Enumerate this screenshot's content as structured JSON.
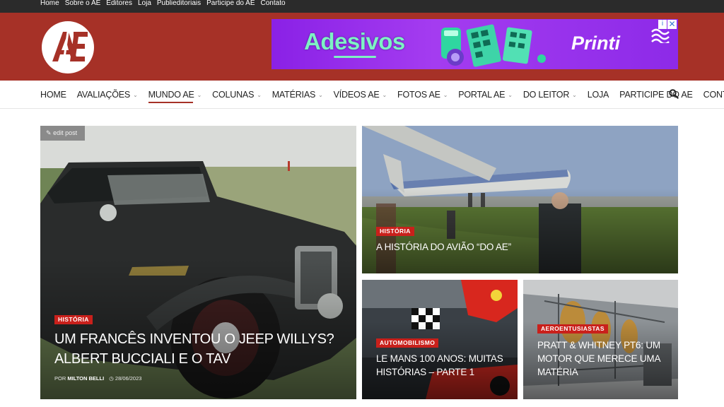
{
  "topbar": {
    "links": [
      "Home",
      "Sobre o AE",
      "Editores",
      "Loja",
      "Publieditoriais",
      "Participe do AE",
      "Contato"
    ]
  },
  "header": {
    "logo_text": "AE",
    "ad": {
      "headline": "Adesivos",
      "brand": "Printi",
      "close_glyph": "✕",
      "info_glyph": "i"
    }
  },
  "nav": {
    "items": [
      {
        "label": "HOME",
        "dropdown": false
      },
      {
        "label": "AVALIAÇÕES",
        "dropdown": true
      },
      {
        "label": "MUNDO AE",
        "dropdown": true
      },
      {
        "label": "COLUNAS",
        "dropdown": true
      },
      {
        "label": "MATÉRIAS",
        "dropdown": true
      },
      {
        "label": "VÍDEOS AE",
        "dropdown": true
      },
      {
        "label": "FOTOS AE",
        "dropdown": true
      },
      {
        "label": "PORTAL AE",
        "dropdown": true
      },
      {
        "label": "DO LEITOR",
        "dropdown": true
      },
      {
        "label": "LOJA",
        "dropdown": false
      },
      {
        "label": "PARTICIPE DO AE",
        "dropdown": false
      },
      {
        "label": "CONTATO",
        "dropdown": false
      }
    ],
    "active_index": 2,
    "chevron_glyph": "⌄"
  },
  "edit_post": "edit post",
  "articles": {
    "main": {
      "category": "HISTÓRIA",
      "title": "UM FRANCÊS INVENTOU O JEEP WILLYS? ALBERT BUCCIALI E O TAV",
      "author_prefix": "POR",
      "author": "MILTON BELLI",
      "date": "28/06/2023"
    },
    "top_right": {
      "category": "HISTÓRIA",
      "title": "A HISTÓRIA DO AVIÃO “DO AE”"
    },
    "bottom_mid": {
      "category": "AUTOMOBILISMO",
      "title": "LE MANS 100 ANOS: MUITAS HISTÓRIAS – PARTE 1"
    },
    "bottom_right": {
      "category": "AEROENTUSIASTAS",
      "title": "PRATT & WHITNEY PT6: UM MOTOR QUE MERECE UMA MATÉRIA"
    }
  },
  "colors": {
    "header_red": "#a63127",
    "category_red": "#c9201b",
    "topbar_dark": "#2b2b2b"
  }
}
